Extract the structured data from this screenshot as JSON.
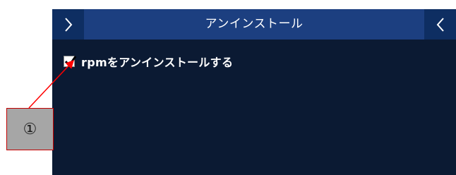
{
  "panel": {
    "title": "アンインストール",
    "background_color": "#0b1a33",
    "titlebar_color": "#1c3f80",
    "nav_button_color": "#0e2e62",
    "prev_icon": "chevron-right-icon",
    "next_icon": "chevron-left-icon"
  },
  "option": {
    "label": "rpmをアンインストールする",
    "checked": true
  },
  "annotation": {
    "marker": "①",
    "box_color": "#a6a6a6",
    "arrow_color": "#ff0000"
  }
}
